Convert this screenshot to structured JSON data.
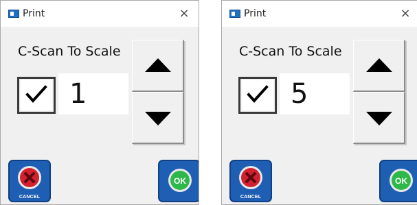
{
  "dialogs": [
    {
      "title": "Print",
      "close_symbol": "×",
      "label": "C-Scan To Scale",
      "checkbox": {
        "checked": true,
        "icon": "check-icon"
      },
      "value": "1",
      "spin_up_icon": "up-arrow-icon",
      "spin_down_icon": "down-arrow-icon",
      "cancel_label": "CANCEL",
      "ok_label": "OK"
    },
    {
      "title": "Print",
      "close_symbol": "×",
      "label": "C-Scan To Scale",
      "checkbox": {
        "checked": true,
        "icon": "check-icon"
      },
      "value": "5",
      "spin_up_icon": "up-arrow-icon",
      "spin_down_icon": "down-arrow-icon",
      "cancel_label": "CANCEL",
      "ok_label": "OK"
    }
  ],
  "colors": {
    "button_blue": "#1f5fb3",
    "cancel_red": "#d2202f",
    "ok_green": "#2fb84a"
  }
}
